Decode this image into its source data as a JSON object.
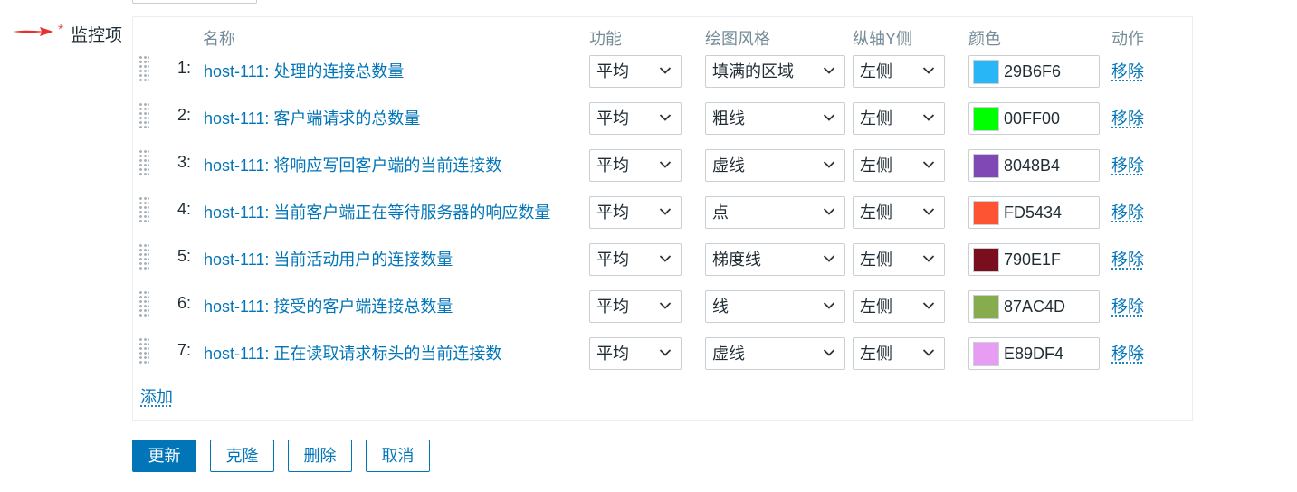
{
  "field": {
    "label": "监控项"
  },
  "headers": {
    "name": "名称",
    "function": "功能",
    "draw_style": "绘图风格",
    "y_axis": "纵轴Y侧",
    "color": "颜色",
    "action": "动作"
  },
  "items": [
    {
      "num": "1:",
      "name": "host-111: 处理的连接总数量",
      "function": "平均",
      "draw_style": "填满的区域",
      "y_axis": "左侧",
      "color": "#29B6F6",
      "color_text": "29B6F6",
      "action": "移除"
    },
    {
      "num": "2:",
      "name": "host-111: 客户端请求的总数量",
      "function": "平均",
      "draw_style": "粗线",
      "y_axis": "左侧",
      "color": "#00FF00",
      "color_text": "00FF00",
      "action": "移除"
    },
    {
      "num": "3:",
      "name": "host-111: 将响应写回客户端的当前连接数",
      "function": "平均",
      "draw_style": "虚线",
      "y_axis": "左侧",
      "color": "#8048B4",
      "color_text": "8048B4",
      "action": "移除"
    },
    {
      "num": "4:",
      "name": "host-111: 当前客户端正在等待服务器的响应数量",
      "function": "平均",
      "draw_style": "点",
      "y_axis": "左侧",
      "color": "#FD5434",
      "color_text": "FD5434",
      "action": "移除"
    },
    {
      "num": "5:",
      "name": "host-111: 当前活动用户的连接数量",
      "function": "平均",
      "draw_style": "梯度线",
      "y_axis": "左侧",
      "color": "#790E1F",
      "color_text": "790E1F",
      "action": "移除"
    },
    {
      "num": "6:",
      "name": "host-111: 接受的客户端连接总数量",
      "function": "平均",
      "draw_style": "线",
      "y_axis": "左侧",
      "color": "#87AC4D",
      "color_text": "87AC4D",
      "action": "移除"
    },
    {
      "num": "7:",
      "name": "host-111: 正在读取请求标头的当前连接数",
      "function": "平均",
      "draw_style": "虚线",
      "y_axis": "左侧",
      "color": "#E89DF4",
      "color_text": "E89DF4",
      "action": "移除"
    }
  ],
  "add_label": "添加",
  "buttons": {
    "update": "更新",
    "clone": "克隆",
    "delete": "删除",
    "cancel": "取消"
  },
  "accent": "#0275B8",
  "annotation_arrow_color": "#E5322D"
}
